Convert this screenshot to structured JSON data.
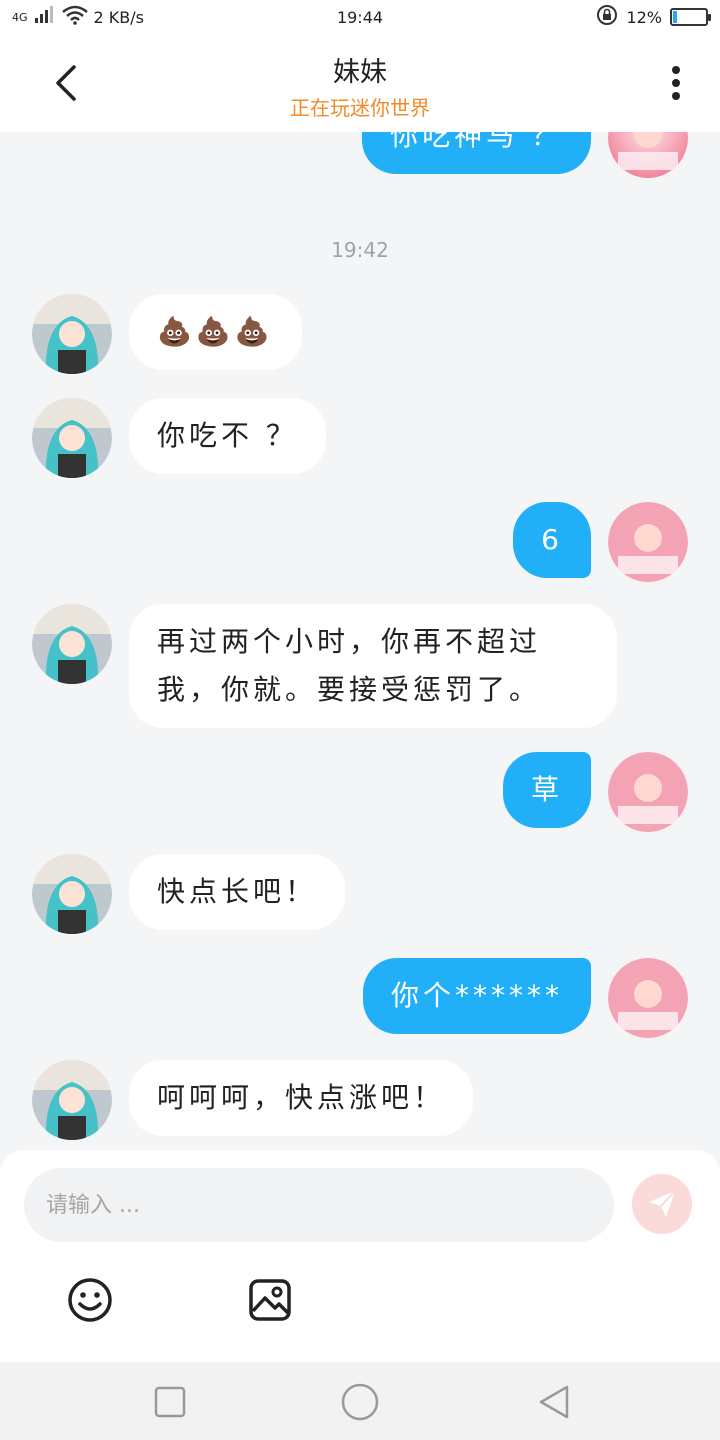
{
  "status_bar": {
    "network": "4G",
    "speed": "2 KB/s",
    "time": "19:44",
    "battery_text": "12%",
    "battery_level": 0.12,
    "accent": "#1eaaf5"
  },
  "header": {
    "title": "妹妹",
    "subtitle": "正在玩迷你世界",
    "back_icon": "chevron-left-icon",
    "more_icon": "more-vertical-icon"
  },
  "messages": {
    "timestamp": "19:42",
    "items": [
      {
        "side": "right",
        "text": "你吃神马 ？"
      },
      {
        "side": "left",
        "text": "💩💩💩"
      },
      {
        "side": "left",
        "text": "你吃不 ？"
      },
      {
        "side": "right",
        "text": "6"
      },
      {
        "side": "left",
        "text": "再过两个小时，你再不超过我，你就。要接受惩罚了。"
      },
      {
        "side": "right",
        "text": "草"
      },
      {
        "side": "left",
        "text": "快点长吧！"
      },
      {
        "side": "right",
        "text": "你个******"
      },
      {
        "side": "left",
        "text": "呵呵呵，快点涨吧！"
      }
    ]
  },
  "composer": {
    "placeholder": "请输入 ...",
    "send_icon": "send-icon",
    "emoji_icon": "emoji-icon",
    "image_icon": "image-icon"
  },
  "colors": {
    "outgoing_bubble": "#21b0f8",
    "incoming_bubble": "#ffffff",
    "subtitle": "#f5892a",
    "background": "#f4f5f7"
  }
}
